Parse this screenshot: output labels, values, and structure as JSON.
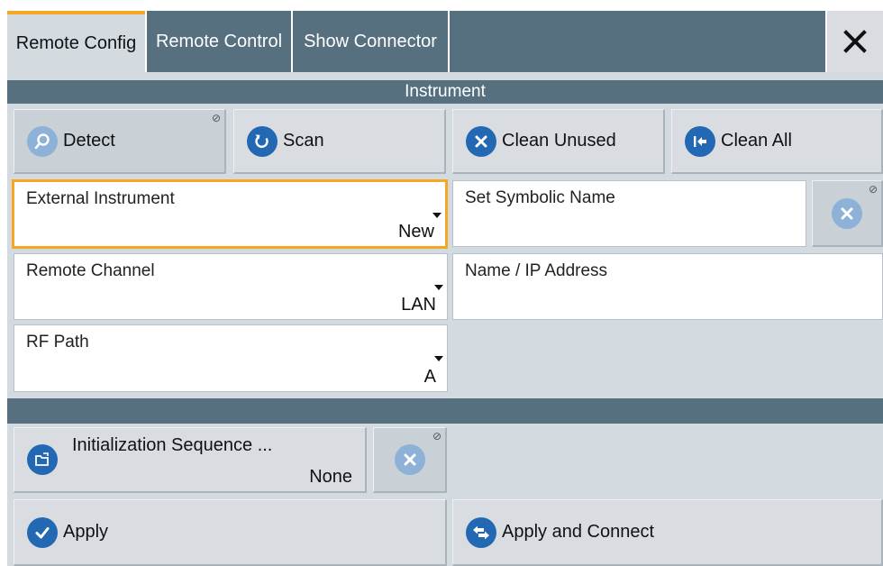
{
  "tabs": [
    {
      "label": "Remote Config",
      "active": true
    },
    {
      "label": "Remote Control",
      "active": false
    },
    {
      "label": "Show Connector",
      "active": false
    }
  ],
  "close_icon": "close-x-icon",
  "instrument_section": {
    "title": "Instrument"
  },
  "buttons": {
    "detect": "Detect",
    "scan": "Scan",
    "clean_unused": "Clean Unused",
    "clean_all": "Clean All",
    "apply": "Apply",
    "apply_connect": "Apply and Connect"
  },
  "fields": {
    "external_instrument": {
      "label": "External Instrument",
      "value": "New"
    },
    "set_symbolic_name": {
      "label": "Set Symbolic Name",
      "value": ""
    },
    "remote_channel": {
      "label": "Remote Channel",
      "value": "LAN"
    },
    "name_ip": {
      "label": "Name / IP Address",
      "value": ""
    },
    "rf_path": {
      "label": "RF Path",
      "value": "A"
    }
  },
  "init_sequence": {
    "label": "Initialization Sequence ...",
    "value": "None"
  },
  "colors": {
    "accent": "#f5a623",
    "header": "#567080",
    "icon_blue": "#2268b2",
    "panel": "#d4dbe0"
  }
}
